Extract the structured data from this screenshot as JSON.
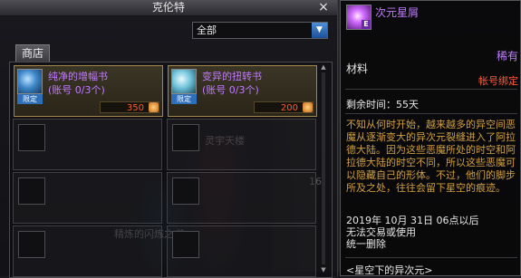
{
  "window": {
    "title": "克伦特",
    "close_label": "×"
  },
  "filter": {
    "value": "全部",
    "arrow": "▼"
  },
  "tabs": [
    {
      "label": "商店"
    }
  ],
  "scroll": {
    "up": "▲",
    "down": "▼"
  },
  "items": [
    {
      "name": "纯净的增幅书",
      "account": "(账号 0/3个)",
      "badge": "限定",
      "price": "350",
      "icon": "amplify-book-icon"
    },
    {
      "name": "变异的扭转书",
      "account": "(账号 0/3个)",
      "badge": "限定",
      "price": "200",
      "icon": "twist-book-icon"
    }
  ],
  "background_text": [
    "灵宇天楼",
    "16",
    "精炼的闪炼之书"
  ],
  "tooltip": {
    "name": "次元星屑",
    "rarity": "稀有",
    "category": "材料",
    "bind": "帐号绑定",
    "remaining": "剩余时间：55天",
    "description": "不知从何时开始，越来越多的异空间恶魔从逐渐变大的异次元裂缝进入了阿拉德大陆。因为这些恶魔所处的时空和阿拉德大陆的时空不同，所以这些恶魔可以隐藏自己的形体。不过，他们的脚步所及之处，往往会留下星空的痕迹。",
    "expire_lines": [
      "2019年 10月 31日 06点以后",
      "无法交易或使用",
      "统一删除"
    ],
    "source": "<星空下的异次元>",
    "icon_letter": "E"
  }
}
